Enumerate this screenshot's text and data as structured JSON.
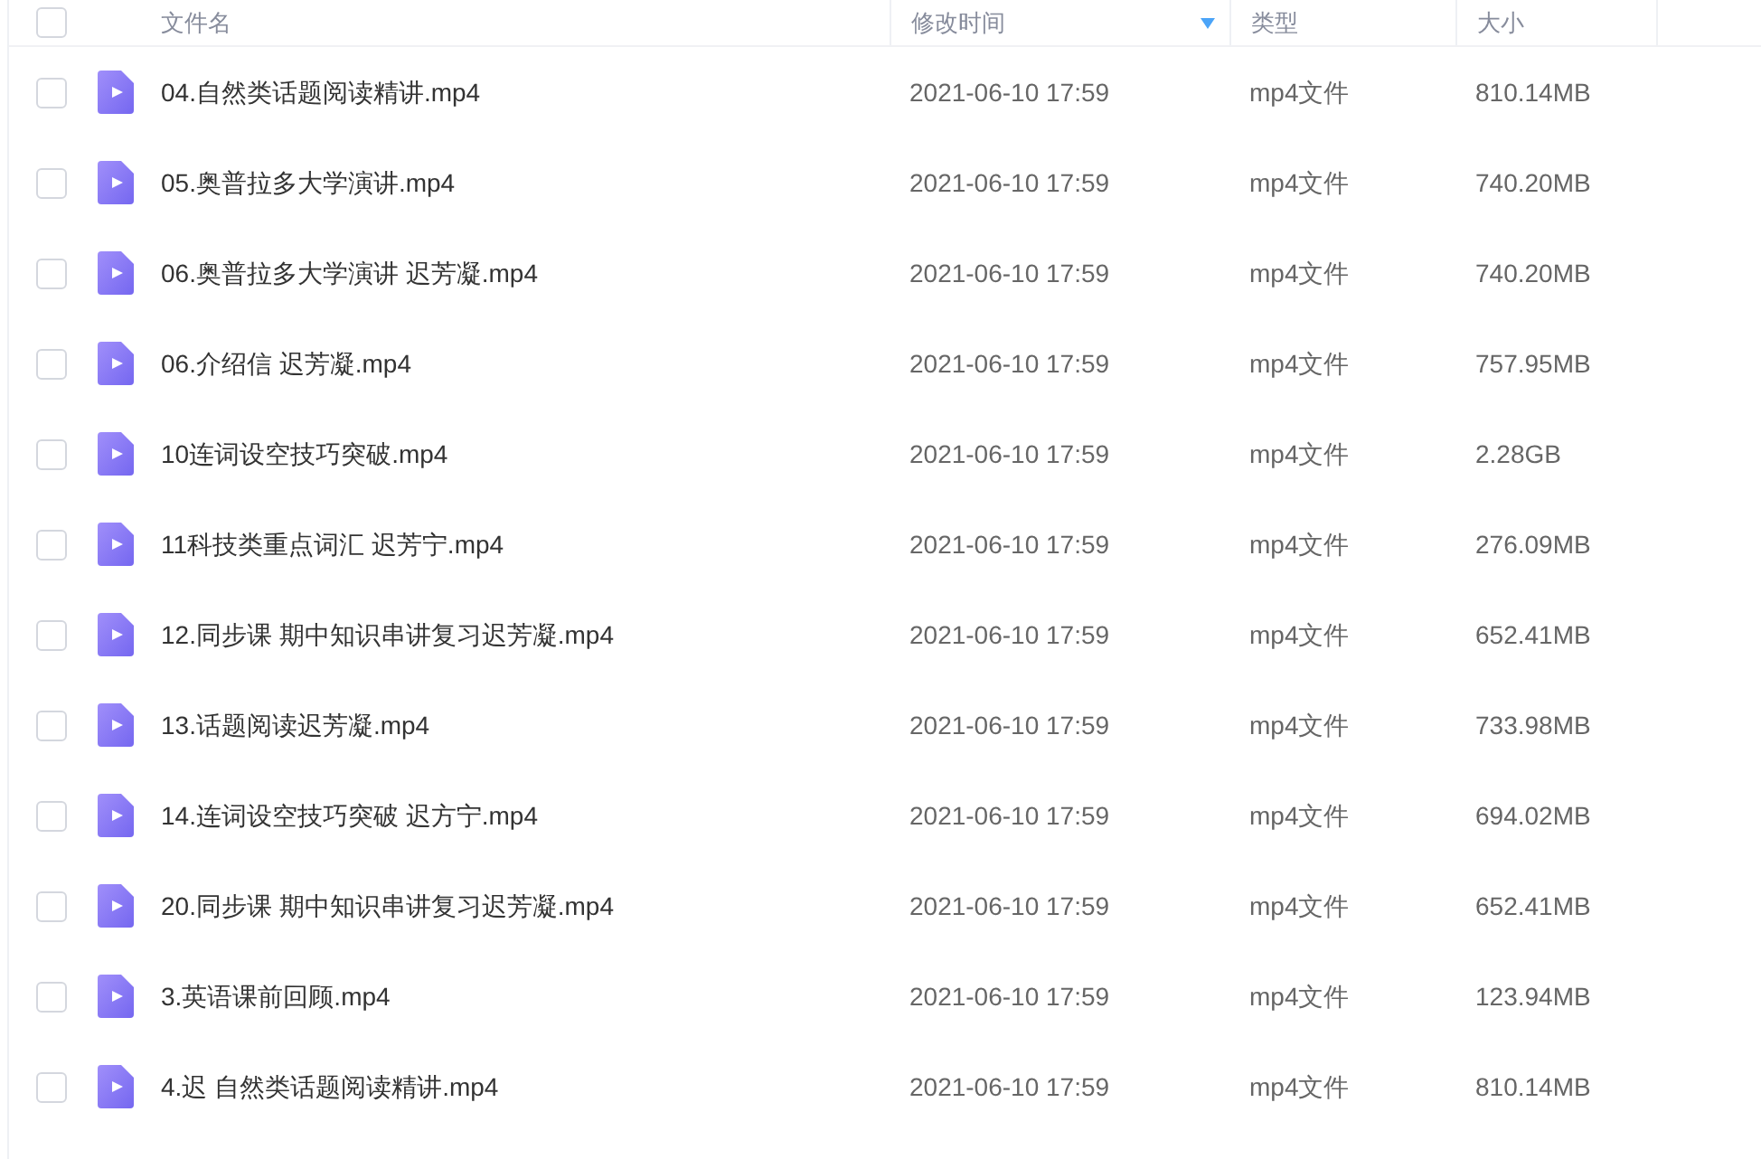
{
  "table": {
    "select_all": {
      "checked": false
    },
    "columns": [
      "文件名",
      "修改时间",
      "类型",
      "大小"
    ],
    "rows": [
      {
        "name": "04.自然类话题阅读精讲.mp4",
        "modified": "2021-06-10 17:59",
        "type": "mp4文件",
        "size": "810.14MB",
        "checked": false
      },
      {
        "name": "05.奥普拉多大学演讲.mp4",
        "modified": "2021-06-10 17:59",
        "type": "mp4文件",
        "size": "740.20MB",
        "checked": false
      },
      {
        "name": "06.奥普拉多大学演讲 迟芳凝.mp4",
        "modified": "2021-06-10 17:59",
        "type": "mp4文件",
        "size": "740.20MB",
        "checked": false
      },
      {
        "name": "06.介绍信 迟芳凝.mp4",
        "modified": "2021-06-10 17:59",
        "type": "mp4文件",
        "size": "757.95MB",
        "checked": false
      },
      {
        "name": "10连词设空技巧突破.mp4",
        "modified": "2021-06-10 17:59",
        "type": "mp4文件",
        "size": "2.28GB",
        "checked": false
      },
      {
        "name": "11科技类重点词汇 迟芳宁.mp4",
        "modified": "2021-06-10 17:59",
        "type": "mp4文件",
        "size": "276.09MB",
        "checked": false
      },
      {
        "name": "12.同步课 期中知识串讲复习迟芳凝.mp4",
        "modified": "2021-06-10 17:59",
        "type": "mp4文件",
        "size": "652.41MB",
        "checked": false
      },
      {
        "name": "13.话题阅读迟芳凝.mp4",
        "modified": "2021-06-10 17:59",
        "type": "mp4文件",
        "size": "733.98MB",
        "checked": false
      },
      {
        "name": "14.连词设空技巧突破 迟方宁.mp4",
        "modified": "2021-06-10 17:59",
        "type": "mp4文件",
        "size": "694.02MB",
        "checked": false
      },
      {
        "name": "20.同步课 期中知识串讲复习迟芳凝.mp4",
        "modified": "2021-06-10 17:59",
        "type": "mp4文件",
        "size": "652.41MB",
        "checked": false
      },
      {
        "name": "3.英语课前回顾.mp4",
        "modified": "2021-06-10 17:59",
        "type": "mp4文件",
        "size": "123.94MB",
        "checked": false
      },
      {
        "name": "4.迟 自然类话题阅读精讲.mp4",
        "modified": "2021-06-10 17:59",
        "type": "mp4文件",
        "size": "810.14MB",
        "checked": false
      }
    ]
  }
}
